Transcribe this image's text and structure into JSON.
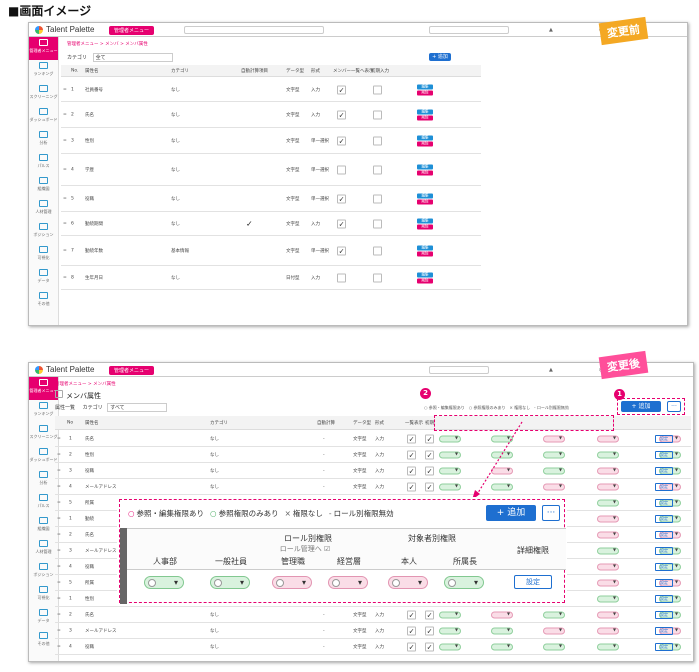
{
  "page_title": "■画面イメージ",
  "tag_before": "変更前",
  "tag_after": "変更後",
  "app_name": "Talent Palette",
  "menu_pill": "管理者メニュー",
  "before": {
    "breadcrumb": [
      "管理者メニュー",
      "メンバ",
      "メンバ属性"
    ],
    "category_label": "カテゴリ",
    "category_value": "全て",
    "add_label": "+ 追加",
    "columns": [
      "No.",
      "属性名",
      "カテゴリ",
      "自動計算項目",
      "データ型",
      "形式",
      "メンバー一覧へ表示",
      "初期入力"
    ],
    "rows": [
      {
        "no": "1",
        "name": "社員番号",
        "cat": "なし",
        "auto": "",
        "type": "文字型",
        "form": "入力",
        "show": true
      },
      {
        "no": "2",
        "name": "氏名",
        "cat": "なし",
        "auto": "",
        "type": "文字型",
        "form": "入力",
        "show": true
      },
      {
        "no": "3",
        "name": "性別",
        "cat": "なし",
        "auto": "",
        "type": "文字型",
        "form": "単一選択",
        "show": true
      },
      {
        "no": "4",
        "name": "学歴",
        "cat": "なし",
        "auto": "",
        "type": "文字型",
        "form": "単一選択",
        "show": false
      },
      {
        "no": "5",
        "name": "役職",
        "cat": "なし",
        "auto": "",
        "type": "文字型",
        "form": "単一選択",
        "show": true
      },
      {
        "no": "6",
        "name": "勤続期間",
        "cat": "なし",
        "auto": "✓",
        "type": "文字型",
        "form": "入力",
        "show": true
      },
      {
        "no": "7",
        "name": "勤続年数",
        "cat": "基本情報",
        "auto": "",
        "type": "文字型",
        "form": "単一選択",
        "show": true
      },
      {
        "no": "8",
        "name": "生年月日",
        "cat": "なし",
        "auto": "",
        "type": "日付型",
        "form": "入力",
        "show": false
      }
    ],
    "btn_edit": "編集",
    "btn_delete": "削除"
  },
  "after": {
    "breadcrumb": "管理者メニュー > メンバ属性",
    "section_title": "メンバ属性",
    "list_label": "属性一覧",
    "category_label": "カテゴリ",
    "category_value": "すべて",
    "legend_small": "○ 参照・編集権限あり　○ 参照権限のみあり　× 権限なし　- ロール別権限無効",
    "add_label": "+ 追加",
    "more_label": "···",
    "rows": [
      {
        "no": "1",
        "name": "氏名",
        "cat": "なし",
        "type": "文字型",
        "form": "入力"
      },
      {
        "no": "2",
        "name": "性別",
        "cat": "なし",
        "type": "文字型",
        "form": "入力"
      },
      {
        "no": "3",
        "name": "役職",
        "cat": "なし",
        "type": "文字型",
        "form": "入力"
      },
      {
        "no": "4",
        "name": "メールアドレス",
        "cat": "なし",
        "type": "文字型",
        "form": "入力"
      },
      {
        "no": "5",
        "name": "所属",
        "cat": "なし",
        "type": "文字型",
        "form": "入力"
      },
      {
        "no": "1",
        "name": "勤続",
        "cat": "なし",
        "type": "文字型",
        "form": "入力"
      },
      {
        "no": "2",
        "name": "氏名",
        "cat": "なし",
        "type": "文字型",
        "form": "入力"
      },
      {
        "no": "3",
        "name": "メールアドレス",
        "cat": "なし",
        "type": "文字型",
        "form": "入力"
      },
      {
        "no": "4",
        "name": "役職",
        "cat": "なし",
        "type": "文字型",
        "form": "入力"
      },
      {
        "no": "5",
        "name": "所属",
        "cat": "なし",
        "type": "文字型",
        "form": "入力"
      },
      {
        "no": "1",
        "name": "性別",
        "cat": "なし",
        "type": "文字型",
        "form": "入力"
      },
      {
        "no": "2",
        "name": "氏名",
        "cat": "なし",
        "type": "文字型",
        "form": "入力"
      },
      {
        "no": "3",
        "name": "メールアドレス",
        "cat": "なし",
        "type": "文字型",
        "form": "入力"
      },
      {
        "no": "4",
        "name": "役職",
        "cat": "なし",
        "type": "文字型",
        "form": "入力"
      }
    ],
    "detail_btn": "設定"
  },
  "zoom": {
    "legend": [
      {
        "sym": "○",
        "text": "参照・編集権限あり",
        "color": "#e6006f"
      },
      {
        "sym": "○",
        "text": "参照権限のみあり",
        "color": "#3aa655"
      },
      {
        "sym": "×",
        "text": "権限なし",
        "color": "#666666"
      },
      {
        "sym": "-",
        "text": "ロール別権限無効",
        "color": "#666666"
      }
    ],
    "add_label": "+ 追加",
    "more_label": "···",
    "group_role": "ロール別権限",
    "group_role_link": "ロール管理へ ☑",
    "group_target": "対象者別権限",
    "cols": [
      "人事部",
      "一般社員",
      "管理職",
      "経営層",
      "本人",
      "所属長"
    ],
    "detail_header": "詳細権限",
    "detail_btn": "設定"
  },
  "sidebar": [
    "管理者メニュー",
    "ランキング",
    "スクリーニング",
    "ダッシュボード",
    "分析",
    "パルス",
    "組織図",
    "人材管理",
    "ポジション",
    "可視化",
    "データ",
    "その他"
  ],
  "colors": {
    "accent": "#e6006f",
    "blue": "#1e6fd0",
    "tag": "#f4a823",
    "tag2": "#ff4f9a"
  }
}
